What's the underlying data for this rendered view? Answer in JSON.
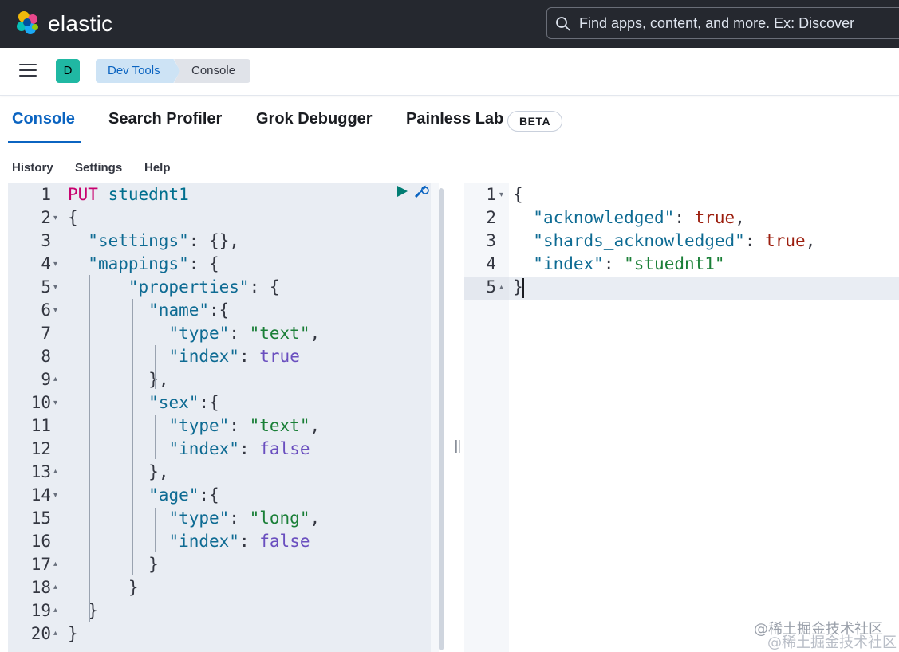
{
  "app": {
    "brand": "elastic"
  },
  "search": {
    "placeholder": "Find apps, content, and more. Ex: Discover"
  },
  "header": {
    "avatar_letter": "D",
    "breadcrumbs": [
      "Dev Tools",
      "Console"
    ]
  },
  "tabs": [
    {
      "label": "Console",
      "active": true
    },
    {
      "label": "Search Profiler",
      "active": false
    },
    {
      "label": "Grok Debugger",
      "active": false
    },
    {
      "label": "Painless Lab",
      "active": false
    }
  ],
  "beta_badge": "BETA",
  "submenu": [
    "History",
    "Settings",
    "Help"
  ],
  "request": {
    "line_numbers": [
      "1",
      "2",
      "3",
      "4",
      "5",
      "6",
      "7",
      "8",
      "9",
      "10",
      "11",
      "12",
      "13",
      "14",
      "15",
      "16",
      "17",
      "18",
      "19",
      "20"
    ],
    "method": "PUT",
    "url": "stuednt1",
    "lines": [
      "{",
      "  \"settings\": {},",
      "  \"mappings\": {",
      "      \"properties\": {",
      "        \"name\":{",
      "          \"type\": \"text\",",
      "          \"index\": true",
      "        },",
      "        \"sex\":{",
      "          \"type\": \"text\",",
      "          \"index\": false",
      "        },",
      "        \"age\":{",
      "          \"type\": \"long\",",
      "          \"index\": false",
      "        }",
      "      }",
      "  }",
      "}"
    ]
  },
  "response": {
    "line_numbers": [
      "1",
      "2",
      "3",
      "4",
      "5"
    ],
    "lines": [
      "{",
      "  \"acknowledged\": true,",
      "  \"shards_acknowledged\": true,",
      "  \"index\": \"stuednt1\"",
      "}"
    ]
  },
  "watermark": "@稀土掘金技术社区",
  "colors": {
    "topbar": "#25282f",
    "accent": "#0b64c1",
    "editor_bg": "#e9edf3",
    "method": "#c8006e",
    "key": "#0e6b93",
    "string": "#1a7f37",
    "bool": "#6a4fbf",
    "bool_response": "#9c1e0e"
  }
}
